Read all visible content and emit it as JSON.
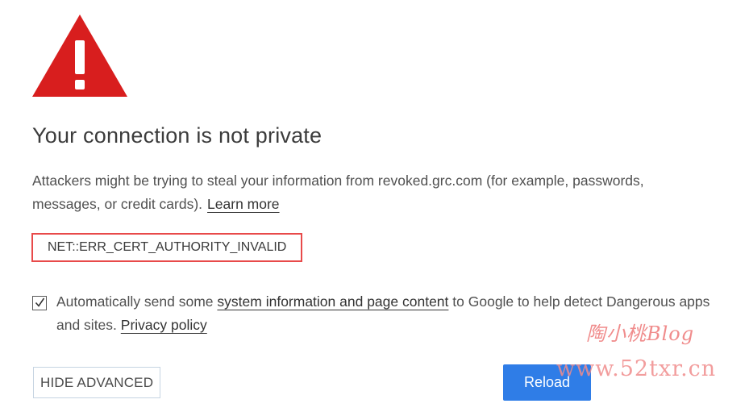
{
  "page": {
    "title": "Your connection is not private",
    "description": "Attackers might be trying to steal your information from revoked.grc.com (for example, passwords, messages, or credit cards).",
    "learn_more_label": "Learn more",
    "error_code": "NET::ERR_CERT_AUTHORITY_INVALID"
  },
  "report": {
    "checked": true,
    "text_before": "Automatically send some",
    "link_label": "system information and page content",
    "text_after": "to Google to help detect Dangerous apps and sites.",
    "privacy_label": "Privacy policy"
  },
  "buttons": {
    "hide_advanced_label": "HIDE ADVANCED",
    "reload_label": "Reload"
  },
  "watermark": {
    "top": "陶小桃Blog",
    "bottom": "www.52txr.cn"
  },
  "colors": {
    "warning_red": "#d81e1e",
    "error_border": "#e84a4a",
    "reload_blue": "#2f7de7",
    "watermark": "#f08c8c"
  },
  "icons": {
    "warning": "warning-triangle-icon",
    "check": "checkmark-icon"
  }
}
